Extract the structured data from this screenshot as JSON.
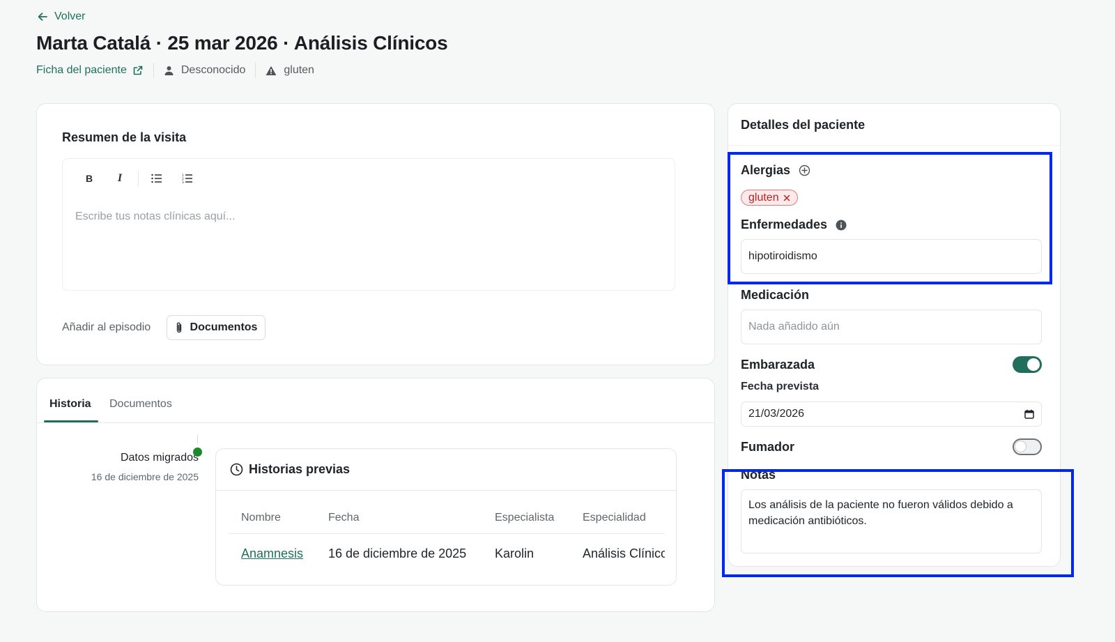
{
  "header": {
    "back_label": "Volver",
    "title": "Marta Catalá · 25 mar 2026 · Análisis Clínicos",
    "patient_link": "Ficha del paciente",
    "gender": "Desconocido",
    "allergy_alert": "gluten"
  },
  "visit": {
    "title": "Resumen de la visita",
    "toolbar": {
      "bold": "B",
      "italic": "I"
    },
    "notes_placeholder": "Escribe tus notas clínicas aquí...",
    "add_label": "Añadir al episodio",
    "documents_button": "Documentos"
  },
  "history": {
    "tabs": [
      "Historia",
      "Documentos"
    ],
    "active_tab": "Historia",
    "timeline": {
      "label": "Datos migrados",
      "date": "16 de diciembre de 2025"
    },
    "previous": {
      "title": "Historias previas",
      "columns": [
        "Nombre",
        "Fecha",
        "Especialista",
        "Especialidad"
      ],
      "rows": [
        {
          "name": "Anamnesis",
          "date": "16 de diciembre de 2025",
          "specialist": "Karolin",
          "specialty": "Análisis Clínicos"
        }
      ]
    }
  },
  "details": {
    "title": "Detalles del paciente",
    "allergies_label": "Alergias",
    "allergies": [
      "gluten"
    ],
    "diseases_label": "Enfermedades",
    "diseases_value": "hipotiroidismo",
    "medication_label": "Medicación",
    "medication_placeholder": "Nada añadido aún",
    "pregnant_label": "Embarazada",
    "pregnant": true,
    "due_date_label": "Fecha prevista",
    "due_date": "21/03/2026",
    "smoker_label": "Fumador",
    "smoker": false,
    "notes_label": "Notas",
    "notes_value": "Los análisis de la paciente no fueron válidos debido a medicación antibióticos."
  },
  "colors": {
    "accent": "#1f6f5c",
    "allergy_chip_bg": "#fde9e9",
    "allergy_chip_text": "#b42323",
    "timeline_dot": "#1a8a2c",
    "highlight": "#0028f0"
  }
}
